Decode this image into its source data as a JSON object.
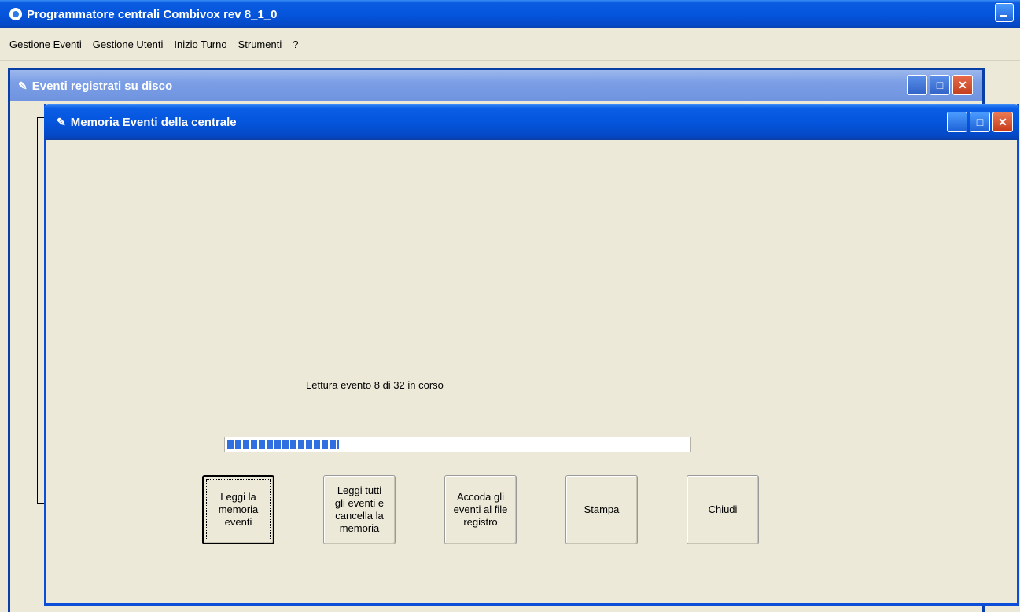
{
  "app": {
    "title": "Programmatore centrali Combivox rev 8_1_0"
  },
  "menu": {
    "items": [
      "Gestione Eventi",
      "Gestione Utenti",
      "Inizio Turno",
      "Strumenti",
      "?"
    ]
  },
  "back_window": {
    "title": "Eventi registrati su disco"
  },
  "dialog": {
    "title": "Memoria Eventi della centrale",
    "status": "Lettura evento 8 di 32 in corso",
    "progress": 0.25,
    "buttons": {
      "read": "Leggi la\nmemoria\neventi",
      "read_all_clear": "Leggi tutti\ngli eventi e\ncancella la\nmemoria",
      "append": "Accoda gli\neventi al file\nregistro",
      "print": "Stampa",
      "close": "Chiudi"
    }
  },
  "colors": {
    "title_active": "#0555dd",
    "title_inactive": "#7b9ee6",
    "window_bg": "#ece9d8",
    "progress": "#2f6fe0"
  }
}
